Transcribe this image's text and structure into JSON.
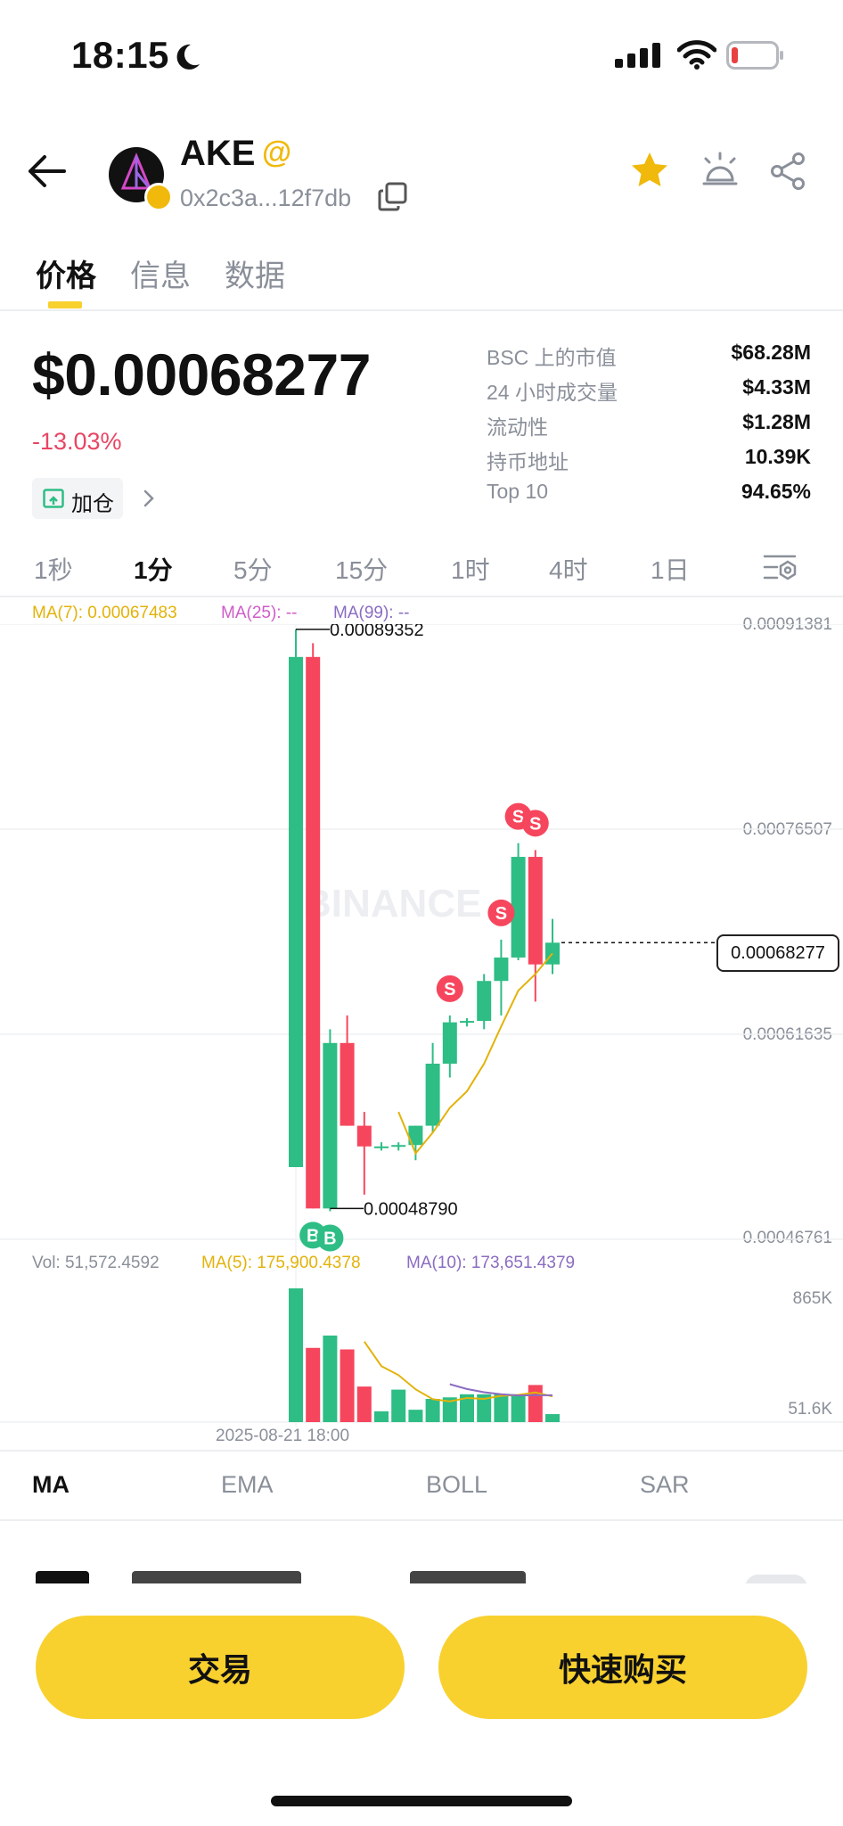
{
  "status": {
    "time": "18:15"
  },
  "header": {
    "token": "AKE",
    "at_symbol": "@",
    "address": "0x2c3a...12f7db"
  },
  "tabs": [
    {
      "label": "价格",
      "active": true
    },
    {
      "label": "信息",
      "active": false
    },
    {
      "label": "数据",
      "active": false
    }
  ],
  "price": {
    "value": "$0.00068277",
    "change": "-13.03%",
    "add_position": "加仓"
  },
  "stats": [
    {
      "label": "BSC 上的市值",
      "value": "$68.28M"
    },
    {
      "label": "24 小时成交量",
      "value": "$4.33M"
    },
    {
      "label": "流动性",
      "value": "$1.28M"
    },
    {
      "label": "持币地址",
      "value": "10.39K"
    },
    {
      "label": "Top 10",
      "value": "94.65%"
    }
  ],
  "intervals": [
    {
      "label": "1秒",
      "active": false
    },
    {
      "label": "1分",
      "active": true
    },
    {
      "label": "5分",
      "active": false
    },
    {
      "label": "15分",
      "active": false
    },
    {
      "label": "1时",
      "active": false
    },
    {
      "label": "4时",
      "active": false
    },
    {
      "label": "1日",
      "active": false
    }
  ],
  "chart": {
    "ma7": "MA(7): 0.00067483",
    "ma25": "MA(25): --",
    "ma99": "MA(99): --",
    "axis": [
      "0.00091381",
      "0.00076507",
      "0.00061635",
      "0.00046761"
    ],
    "current_price": "0.00068277",
    "high_label": "0.00089352",
    "low_label": "0.00048790",
    "watermark": "BINANCE",
    "buy_marker": "B",
    "sell_marker": "S",
    "vol": "Vol: 51,572.4592",
    "vol_ma5": "MA(5): 175,900.4378",
    "vol_ma10": "MA(10): 173,651.4379",
    "vol_axis": [
      "865K",
      "51.6K"
    ],
    "date": "2025-08-21 18:00",
    "colors": {
      "up": "#2ebd85",
      "down": "#f6465d",
      "ma": "#e3b20a",
      "ma10": "#8a6cc1"
    }
  },
  "chart_data": {
    "type": "candlestick",
    "title": "",
    "xlabel": "",
    "ylabel": "",
    "ylim": [
      0.00046761,
      0.00091381
    ],
    "candles": [
      {
        "o": 0.00052,
        "h": 0.00091,
        "l": 0.00052,
        "c": 0.00089
      },
      {
        "o": 0.00089,
        "h": 0.0009,
        "l": 0.00049,
        "c": 0.00049
      },
      {
        "o": 0.00049,
        "h": 0.00062,
        "l": 0.000488,
        "c": 0.00061
      },
      {
        "o": 0.00061,
        "h": 0.00063,
        "l": 0.00055,
        "c": 0.00055
      },
      {
        "o": 0.00055,
        "h": 0.00056,
        "l": 0.0005,
        "c": 0.000535
      },
      {
        "o": 0.000535,
        "h": 0.000538,
        "l": 0.000532,
        "c": 0.000535
      },
      {
        "o": 0.000535,
        "h": 0.000538,
        "l": 0.000532,
        "c": 0.000536
      },
      {
        "o": 0.000536,
        "h": 0.00055,
        "l": 0.000525,
        "c": 0.00055
      },
      {
        "o": 0.00055,
        "h": 0.00061,
        "l": 0.000545,
        "c": 0.000595
      },
      {
        "o": 0.000595,
        "h": 0.00063,
        "l": 0.000585,
        "c": 0.000625
      },
      {
        "o": 0.000625,
        "h": 0.000628,
        "l": 0.000622,
        "c": 0.000626
      },
      {
        "o": 0.000626,
        "h": 0.00066,
        "l": 0.00062,
        "c": 0.000655
      },
      {
        "o": 0.000655,
        "h": 0.000685,
        "l": 0.00063,
        "c": 0.000672
      },
      {
        "o": 0.000672,
        "h": 0.000755,
        "l": 0.00067,
        "c": 0.000745
      },
      {
        "o": 0.000745,
        "h": 0.00075,
        "l": 0.00064,
        "c": 0.000667
      },
      {
        "o": 0.000667,
        "h": 0.0007,
        "l": 0.00066,
        "c": 0.00068277
      }
    ],
    "ma7": [
      null,
      null,
      null,
      null,
      null,
      null,
      0.00056,
      0.00053,
      0.000545,
      0.000563,
      0.000575,
      0.000595,
      0.000622,
      0.000648,
      0.00066,
      0.000675
    ],
    "volume": [
      865000,
      480000,
      560000,
      470000,
      230000,
      70000,
      210000,
      80000,
      150000,
      160000,
      180000,
      180000,
      180000,
      180000,
      240000,
      51600
    ],
    "volume_ma5": [
      null,
      null,
      null,
      null,
      521000,
      362000,
      304000,
      212000,
      148000,
      134000,
      156000,
      150000,
      170000,
      176000,
      192000,
      166000
    ],
    "volume_ma10": [
      null,
      null,
      null,
      null,
      null,
      null,
      null,
      null,
      null,
      245000,
      214000,
      193000,
      180000,
      172000,
      174000,
      173651
    ],
    "buys": [
      1,
      2
    ],
    "sells": [
      9,
      12,
      13,
      14
    ],
    "volume_ylim": [
      0,
      865000
    ]
  },
  "indicators": [
    {
      "label": "MA",
      "active": true
    },
    {
      "label": "EMA",
      "active": false
    },
    {
      "label": "BOLL",
      "active": false
    },
    {
      "label": "SAR",
      "active": false
    }
  ],
  "buttons": {
    "trade": "交易",
    "quick_buy": "快速购买"
  }
}
